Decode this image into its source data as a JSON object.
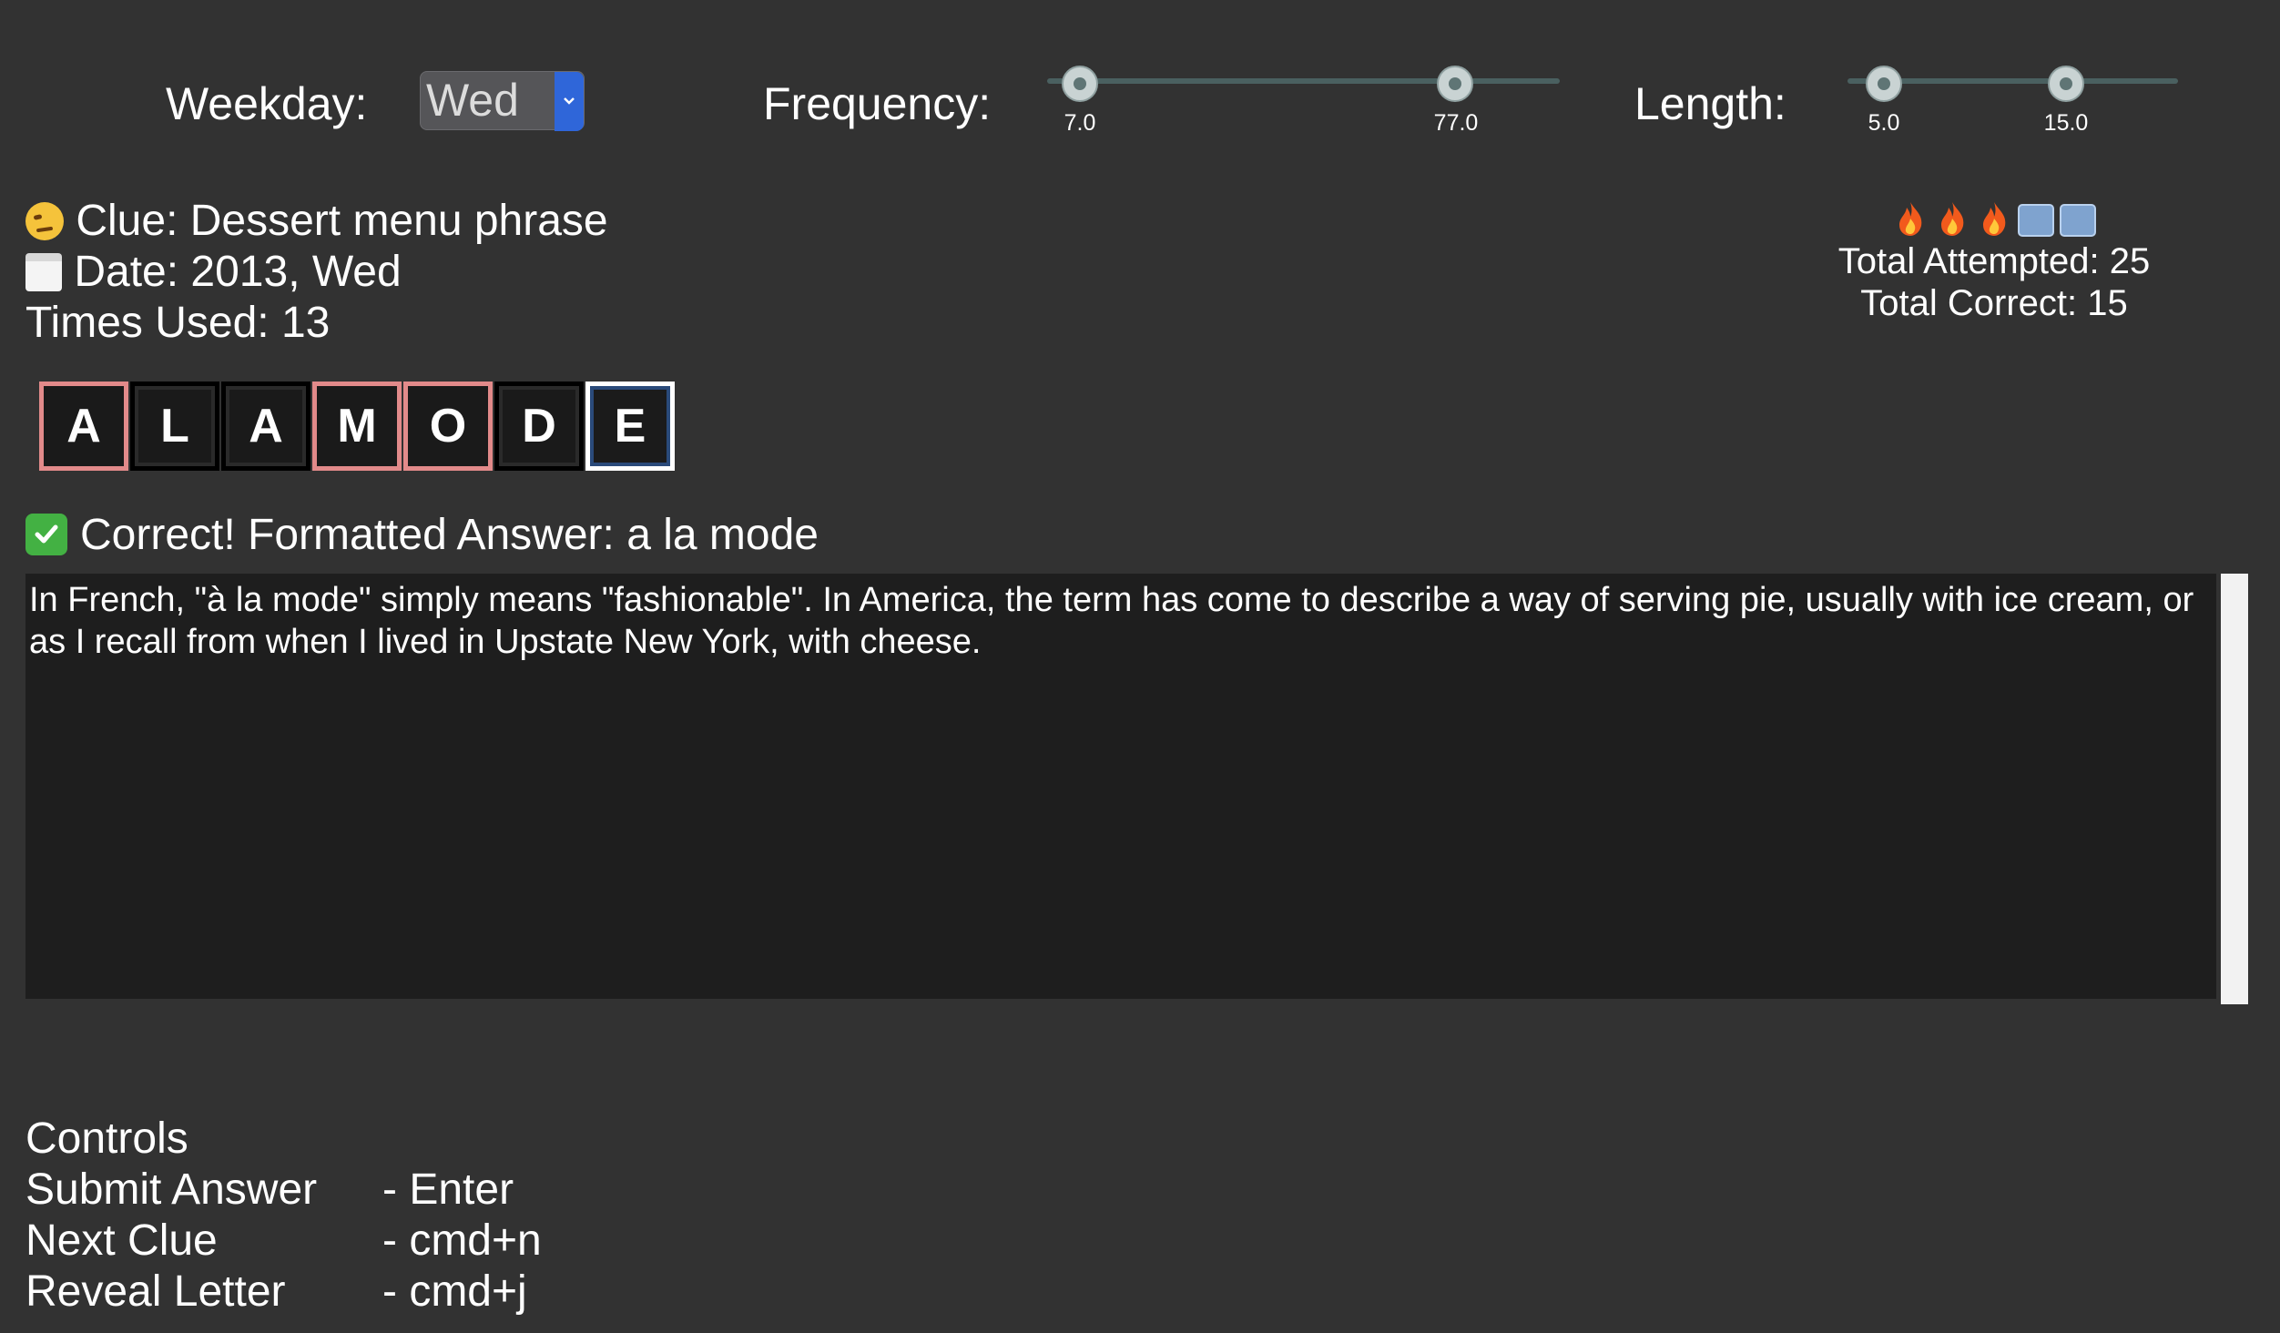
{
  "filters": {
    "weekday_label": "Weekday:",
    "weekday_value": "Wed",
    "frequency_label": "Frequency:",
    "frequency_min": "7.0",
    "frequency_max": "77.0",
    "length_label": "Length:",
    "length_min": "5.0",
    "length_max": "15.0"
  },
  "clue": {
    "clue_text": "Clue: Dessert menu phrase",
    "date_text": "Date: 2013, Wed",
    "times_used": "Times Used: 13",
    "clue_icon": "raised-eyebrow-face-icon",
    "date_icon": "calendar-icon"
  },
  "stats": {
    "streak": [
      "fire",
      "fire",
      "fire",
      "ice",
      "ice"
    ],
    "total_attempted": "Total Attempted: 25",
    "total_correct": "Total Correct: 15"
  },
  "answer": {
    "tiles": [
      {
        "letter": "A",
        "state": "revealed"
      },
      {
        "letter": "L",
        "state": "normal"
      },
      {
        "letter": "A",
        "state": "normal"
      },
      {
        "letter": "M",
        "state": "revealed"
      },
      {
        "letter": "O",
        "state": "revealed"
      },
      {
        "letter": "D",
        "state": "normal"
      },
      {
        "letter": "E",
        "state": "focused"
      }
    ],
    "result": "Correct! Formatted Answer: a la mode"
  },
  "explanation": "In French, \"à la mode\" simply means \"fashionable\". In America, the term has come to describe a way of serving pie, usually with ice cream, or as I recall from when I lived in Upstate New York, with cheese.",
  "controls": {
    "title": "Controls",
    "rows": [
      {
        "action": "Submit Answer",
        "key": "- Enter"
      },
      {
        "action": "Next Clue",
        "key": "- cmd+n"
      },
      {
        "action": "Reveal Letter",
        "key": "- cmd+j"
      }
    ]
  },
  "colors": {
    "background": "#323232",
    "revealed_border": "#e28a8a",
    "select_arrow": "#2f66d9",
    "slider_thumb": "#c9d3d3"
  }
}
